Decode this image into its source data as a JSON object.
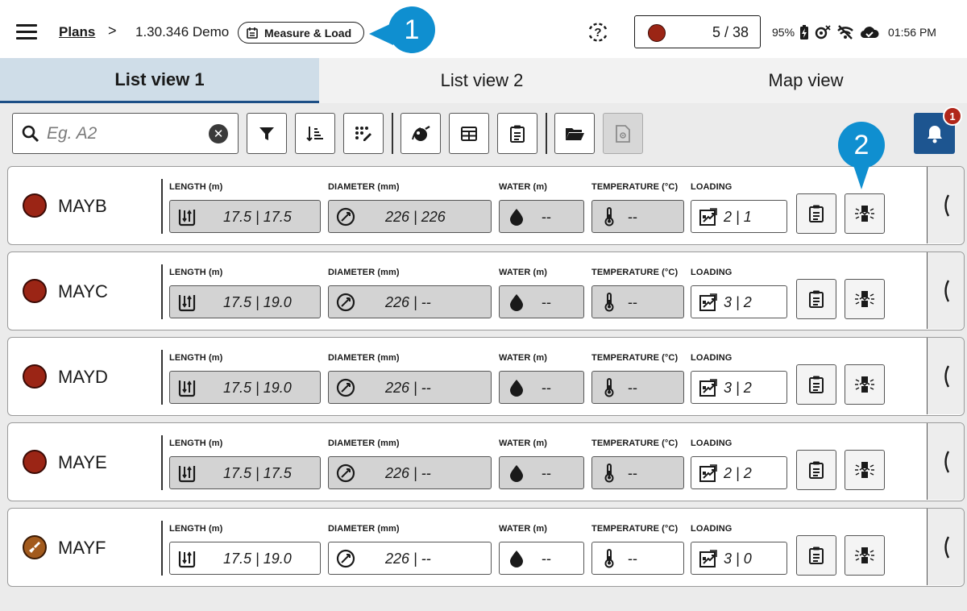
{
  "topbar": {
    "crumb_plans": "Plans",
    "crumb_separator": ">",
    "crumb_plan": "1.30.346 Demo",
    "mode": "Measure & Load",
    "counter": "5 / 38",
    "battery": "95%",
    "time": "01:56 PM"
  },
  "callouts": {
    "one": "1",
    "two": "2"
  },
  "tabs": [
    "List view 1",
    "List view 2",
    "Map view"
  ],
  "search": {
    "placeholder": "Eg. A2",
    "clear": "✕"
  },
  "notifications": {
    "count": "1"
  },
  "labels": {
    "length": "LENGTH (m)",
    "diameter": "DIAMETER (mm)",
    "water": "WATER (m)",
    "temperature": "TEMPERATURE (°C)",
    "loading": "LOADING"
  },
  "rows": [
    {
      "name": "MAYB",
      "length": "17.5 | 17.5",
      "diameter": "226 | 226",
      "water": "--",
      "temperature": "--",
      "loading": "2 | 1",
      "status": "red"
    },
    {
      "name": "MAYC",
      "length": "17.5 | 19.0",
      "diameter": "226 | --",
      "water": "--",
      "temperature": "--",
      "loading": "3 | 2",
      "status": "red"
    },
    {
      "name": "MAYD",
      "length": "17.5 | 19.0",
      "diameter": "226 | --",
      "water": "--",
      "temperature": "--",
      "loading": "3 | 2",
      "status": "red"
    },
    {
      "name": "MAYE",
      "length": "17.5 | 17.5",
      "diameter": "226 | --",
      "water": "--",
      "temperature": "--",
      "loading": "2 | 2",
      "status": "red"
    },
    {
      "name": "MAYF",
      "length": "17.5 | 19.0",
      "diameter": "226 | --",
      "water": "--",
      "temperature": "--",
      "loading": "3 | 0",
      "status": "brown"
    }
  ],
  "colors": {
    "status_red": "#9b2515",
    "status_brown": "#a25a1d",
    "accent_blue": "#1d5590",
    "callout_blue": "#0f8fd0",
    "active_tab": "#cfdde8"
  }
}
